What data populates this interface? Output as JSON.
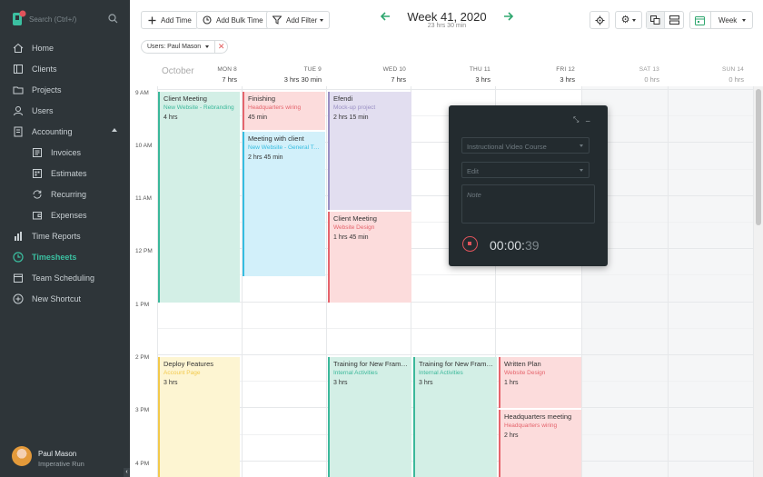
{
  "sidebar": {
    "search_placeholder": "Search (Ctrl+/)",
    "items": [
      {
        "label": "Home",
        "icon": "home-icon"
      },
      {
        "label": "Clients",
        "icon": "clients-icon"
      },
      {
        "label": "Projects",
        "icon": "folder-icon"
      },
      {
        "label": "Users",
        "icon": "user-icon"
      },
      {
        "label": "Accounting",
        "icon": "accounting-icon"
      },
      {
        "label": "Invoices",
        "icon": "invoice-icon"
      },
      {
        "label": "Estimates",
        "icon": "estimate-icon"
      },
      {
        "label": "Recurring",
        "icon": "recurring-icon"
      },
      {
        "label": "Expenses",
        "icon": "wallet-icon"
      },
      {
        "label": "Time Reports",
        "icon": "chart-icon"
      },
      {
        "label": "Timesheets",
        "icon": "clock-icon"
      },
      {
        "label": "Team Scheduling",
        "icon": "team-icon"
      },
      {
        "label": "New Shortcut",
        "icon": "plus-circle-icon"
      }
    ],
    "user": {
      "name": "Paul Mason",
      "org": "Imperative Run"
    }
  },
  "toolbar": {
    "add_time": "Add Time",
    "add_bulk_time": "Add Bulk Time",
    "add_filter": "Add Filter",
    "week_title": "Week 41, 2020",
    "week_total": "23 hrs 30 min",
    "view_select": "Week"
  },
  "filter": {
    "label": "Users: Paul Mason"
  },
  "calendar": {
    "month": "October",
    "days": [
      {
        "name": "MON 8",
        "hours": "7 hrs"
      },
      {
        "name": "TUE 9",
        "hours": "3 hrs 30 min"
      },
      {
        "name": "WED 10",
        "hours": "7 hrs"
      },
      {
        "name": "THU 11",
        "hours": "3 hrs"
      },
      {
        "name": "FRI 12",
        "hours": "3 hrs"
      },
      {
        "name": "SAT 13",
        "hours": "0 hrs"
      },
      {
        "name": "SUN 14",
        "hours": "0 hrs"
      }
    ],
    "hours": [
      "9 AM",
      "10 AM",
      "11 AM",
      "12 PM",
      "1 PM",
      "2 PM",
      "3 PM",
      "4 PM"
    ],
    "events": [
      {
        "title": "Client Meeting",
        "project": "New Website - Rebranding",
        "duration": "4 hrs",
        "color": "#3bb89a",
        "bg": "#d3efe6"
      },
      {
        "title": "Finishing",
        "project": "Headquarters wiring",
        "duration": "45 min",
        "color": "#e5646c",
        "bg": "#fcdcdc"
      },
      {
        "title": "Meeting with client",
        "project": "New Website - General Tasks",
        "duration": "2 hrs 45 min",
        "color": "#35bde0",
        "bg": "#d2f0fa"
      },
      {
        "title": "Efendi",
        "project": "Mock-up project",
        "duration": "2 hrs 15 min",
        "color": "#9a90c4",
        "bg": "#e2def0"
      },
      {
        "title": "Client Meeting",
        "project": "Website Design",
        "duration": "1 hrs 45 min",
        "color": "#e5646c",
        "bg": "#fcdcdc"
      },
      {
        "title": "Deploy Features",
        "project": "Account Page",
        "duration": "3 hrs",
        "color": "#f2c94c",
        "bg": "#fdf5d2"
      },
      {
        "title": "Training for New Framew...",
        "project": "Internal Activities",
        "duration": "3 hrs",
        "color": "#3bb89a",
        "bg": "#d3efe6"
      },
      {
        "title": "Training for New Framew...",
        "project": "Internal Activities",
        "duration": "3 hrs",
        "color": "#3bb89a",
        "bg": "#d3efe6"
      },
      {
        "title": "Written Plan",
        "project": "Website Design",
        "duration": "1 hrs",
        "color": "#e5646c",
        "bg": "#fcdcdc"
      },
      {
        "title": "Headquarters meeting",
        "project": "Headquarters wiring",
        "duration": "2 hrs",
        "color": "#e5646c",
        "bg": "#fcdcdc"
      }
    ]
  },
  "timer": {
    "project_placeholder": "Instructional Video Course",
    "task_placeholder": "Edit",
    "note_placeholder": "Note",
    "time_main": "00:00:",
    "time_sec": "39"
  }
}
